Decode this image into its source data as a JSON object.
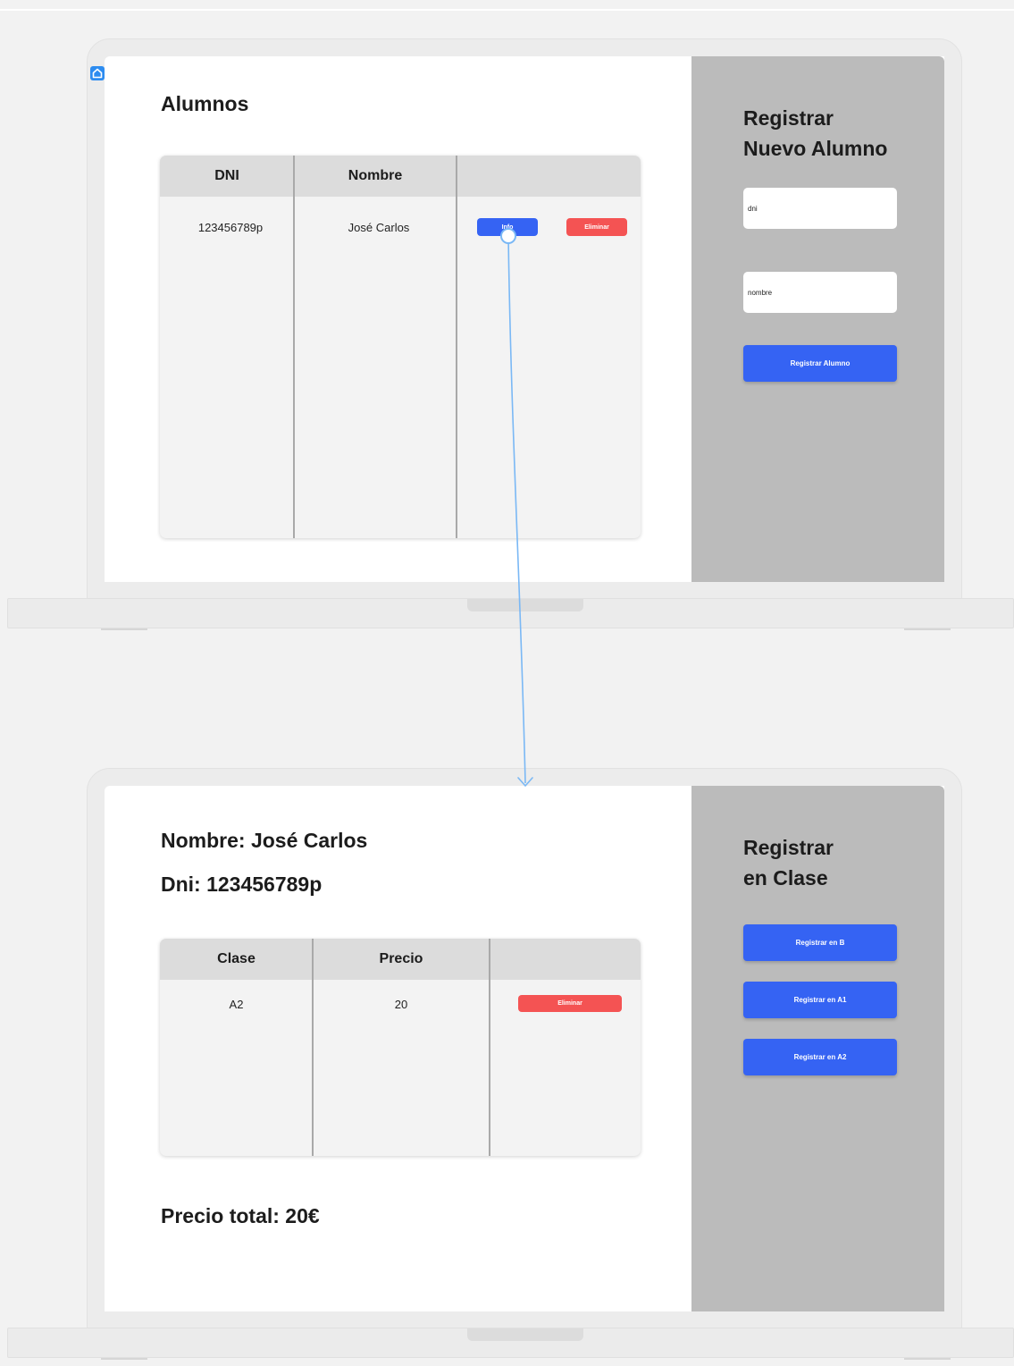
{
  "screen_list": {
    "heading": "Alumnos",
    "table": {
      "headers": [
        "DNI",
        "Nombre",
        ""
      ],
      "rows": [
        {
          "dni": "123456789p",
          "nombre": "José Carlos",
          "info_label": "Info",
          "delete_label": "Eliminar"
        }
      ]
    },
    "side": {
      "title_line1": "Registrar",
      "title_line2": "Nuevo Alumno",
      "dni_value": "dni",
      "nombre_value": "nombre",
      "submit_label": "Registrar Alumno"
    }
  },
  "screen_detail": {
    "nombre_line": "Nombre: José Carlos",
    "dni_line": "Dni: 123456789p",
    "table": {
      "headers": [
        "Clase",
        "Precio",
        ""
      ],
      "rows": [
        {
          "clase": "A2",
          "precio": "20",
          "delete_label": "Eliminar"
        }
      ]
    },
    "total_line": "Precio total: 20€",
    "side": {
      "title_line1": "Registrar",
      "title_line2": "en Clase",
      "buttons": [
        "Registrar en B",
        "Registrar en A1",
        "Registrar en A2"
      ]
    }
  },
  "colors": {
    "accent": "#3563f3",
    "danger": "#f45353",
    "panel": "#bbbbbb",
    "connector": "#7ab8f5",
    "home_icon": "#2d8cf0"
  },
  "icons": {
    "home": "home-icon",
    "flow_arrow": "arrow-down-icon"
  }
}
